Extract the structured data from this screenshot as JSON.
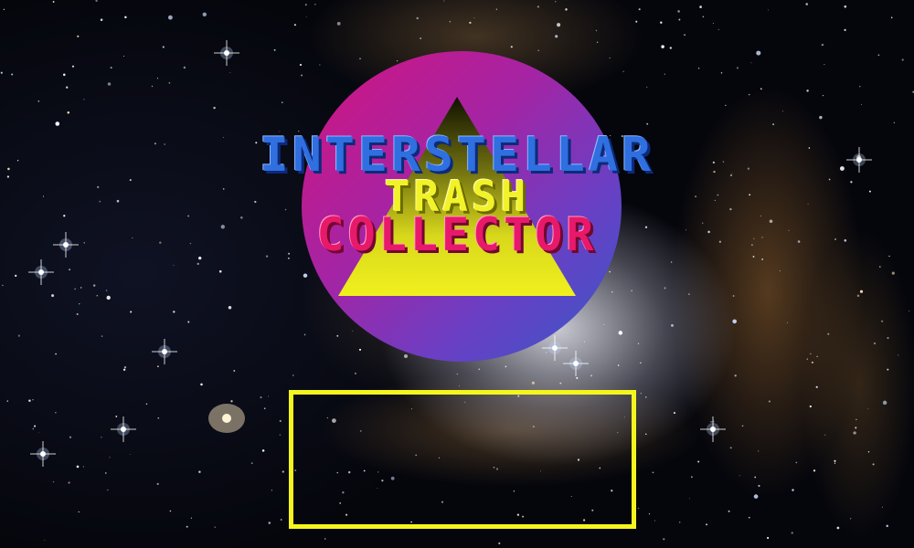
{
  "title": {
    "line1": "INTERSTELLAR",
    "line2": "TRASH",
    "line3": "COLLECTOR"
  },
  "colors": {
    "title_line1": "#2f6fe0",
    "title_line2": "#f2f22a",
    "title_line3": "#e8196a",
    "disc_gradient_start": "#d4147e",
    "disc_gradient_end": "#3659c9",
    "triangle_top": "#1a1a00",
    "triangle_bottom": "#f0f01e",
    "menu_frame": "#f5f51e"
  },
  "icons": {
    "logo_emblem": "pyramid-in-circle-icon"
  }
}
